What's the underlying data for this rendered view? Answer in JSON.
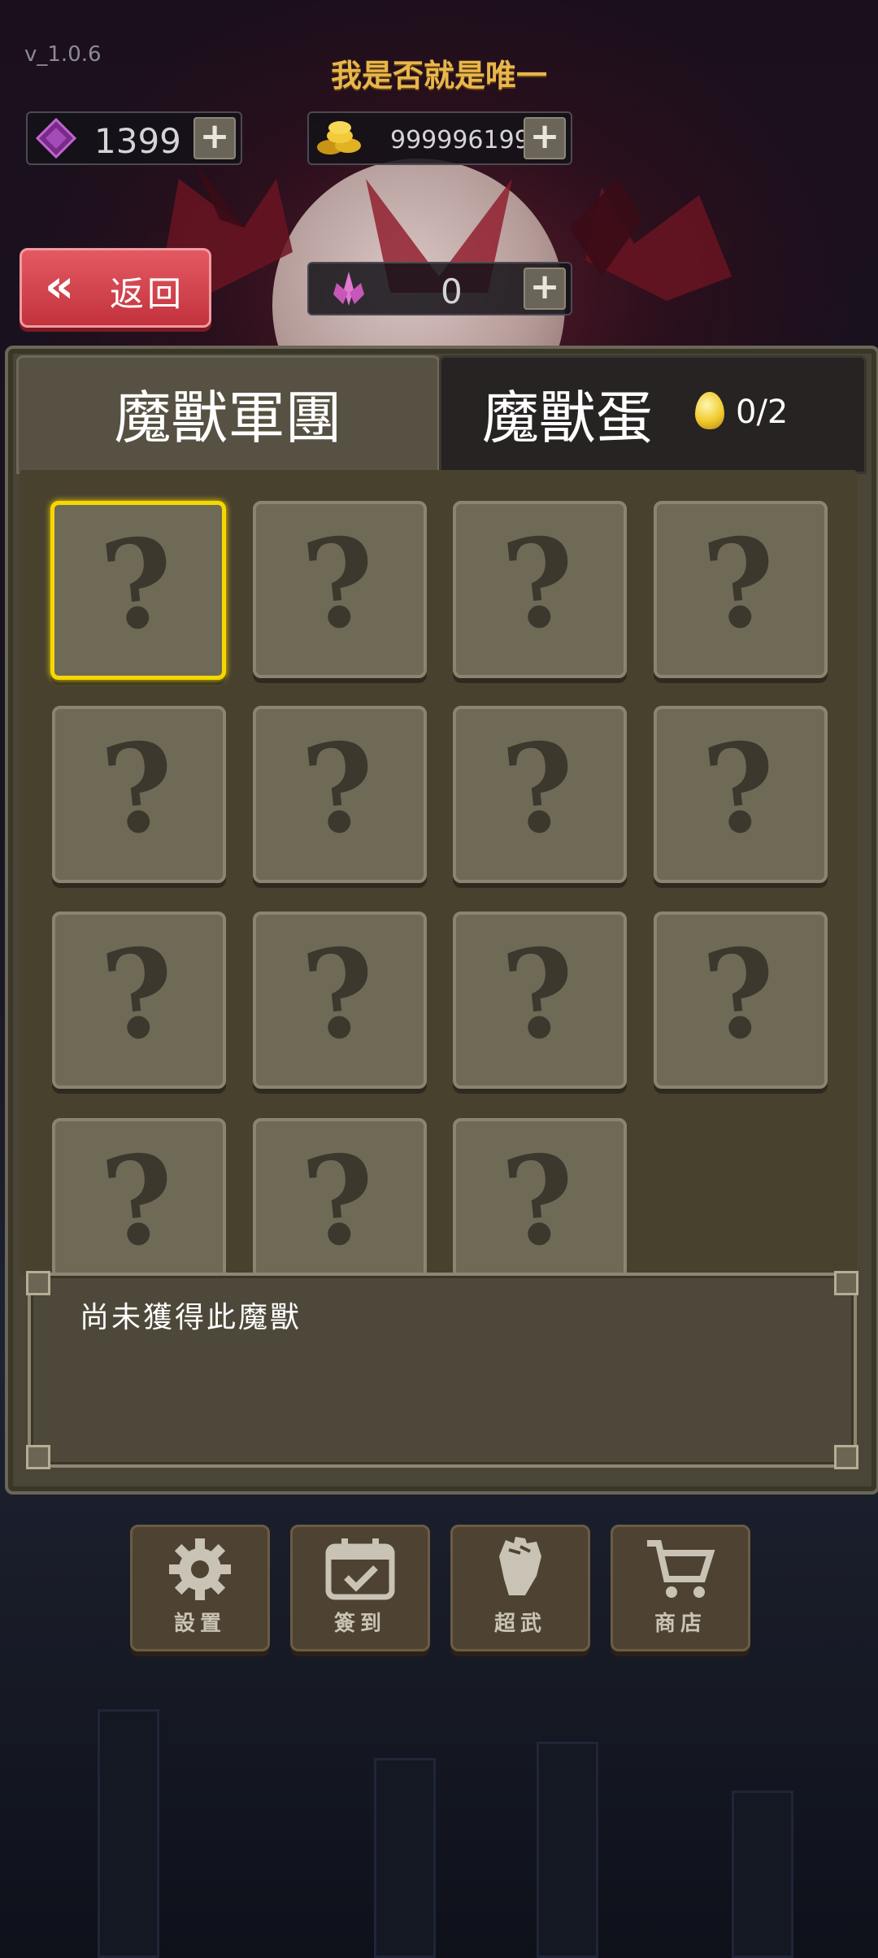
{
  "version": "v_1.0.6",
  "title": "我是否就是唯一",
  "resources": {
    "gems": "1399",
    "gold": "999996199",
    "crystals": "0",
    "plus": "+"
  },
  "back_button": {
    "icon": "«",
    "label": "返回"
  },
  "tabs": [
    {
      "label": "魔獸軍團",
      "active": true
    },
    {
      "label": "魔獸蛋",
      "egg_count": "0/2",
      "active": false
    }
  ],
  "monster_grid": {
    "unknown_symbol": "?",
    "selected_index": 0,
    "slots": 15
  },
  "description": "尚未獲得此魔獸",
  "bottom_menu": [
    {
      "label": "設置",
      "icon": "gear-icon"
    },
    {
      "label": "簽到",
      "icon": "calendar-check-icon"
    },
    {
      "label": "超武",
      "icon": "fist-icon"
    },
    {
      "label": "商店",
      "icon": "cart-icon"
    }
  ],
  "colors": {
    "title_gold": "#e8b64a",
    "back_red": "#d9444e",
    "selected_border": "#f6d800",
    "panel": "#4a4536"
  }
}
